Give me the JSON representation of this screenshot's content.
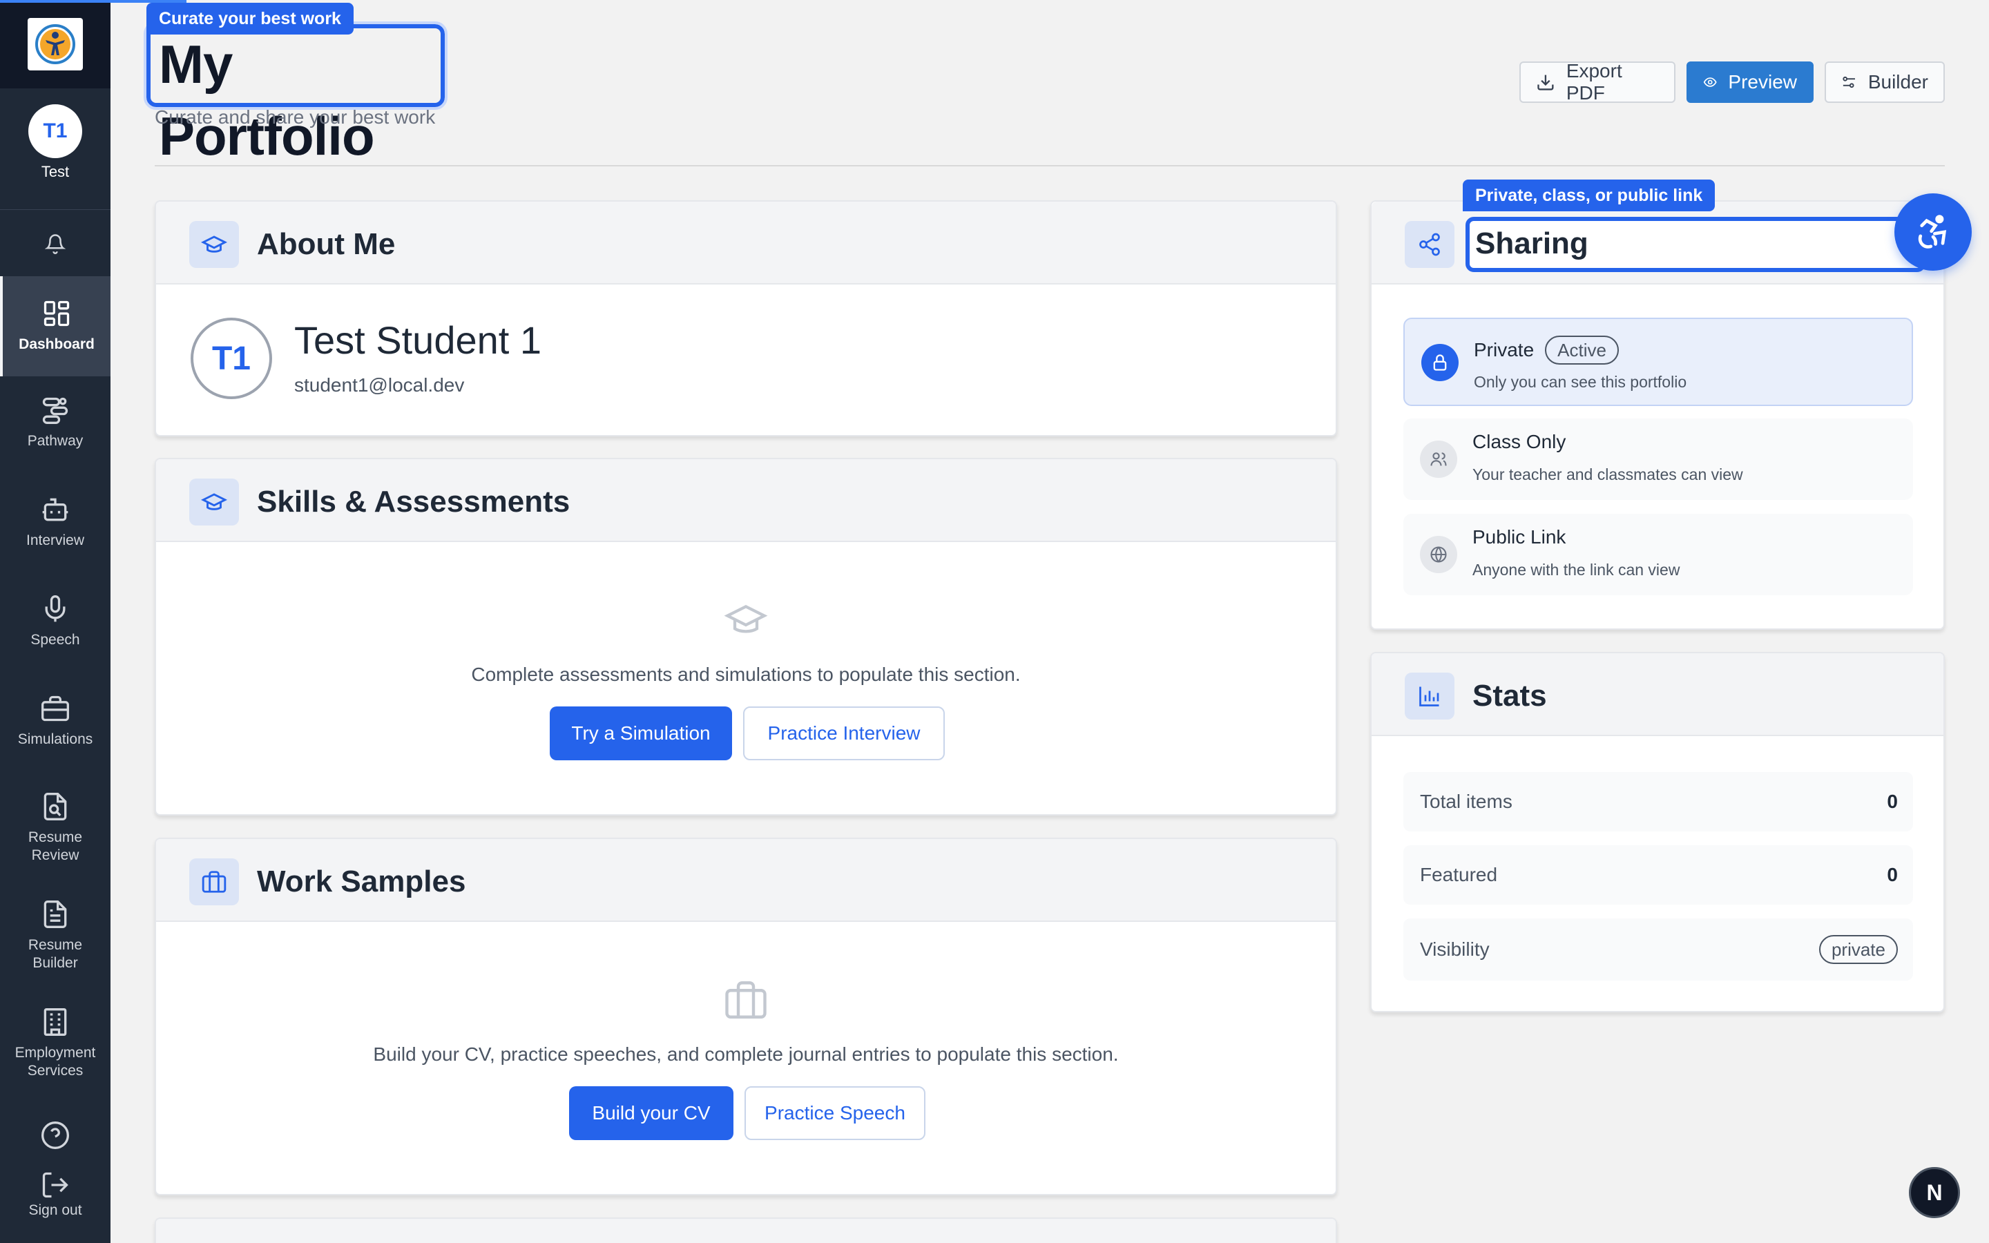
{
  "sidebar": {
    "profile": {
      "initials": "T1",
      "name": "Test"
    },
    "items": [
      {
        "label": "Dashboard",
        "icon": "dashboard-icon",
        "active": true
      },
      {
        "label": "Pathway",
        "icon": "pathway-icon"
      },
      {
        "label": "Interview",
        "icon": "robot-icon"
      },
      {
        "label": "Speech",
        "icon": "microphone-icon"
      },
      {
        "label": "Simulations",
        "icon": "briefcase-icon"
      },
      {
        "label": "Resume Review",
        "icon": "file-search-icon"
      },
      {
        "label": "Resume Builder",
        "icon": "file-text-icon"
      },
      {
        "label": "Employment Services",
        "icon": "building-icon"
      }
    ],
    "sign_out": "Sign out"
  },
  "header": {
    "tooltip": "Curate your best work",
    "title": "My Portfolio",
    "subtitle": "Curate and share your best work",
    "buttons": {
      "export": "Export PDF",
      "preview": "Preview",
      "builder": "Builder"
    }
  },
  "about": {
    "title": "About Me",
    "initials": "T1",
    "name": "Test Student 1",
    "email": "student1@local.dev"
  },
  "skills": {
    "title": "Skills & Assessments",
    "empty_text": "Complete assessments and simulations to populate this section.",
    "primary_button": "Try a Simulation",
    "secondary_button": "Practice Interview"
  },
  "work": {
    "title": "Work Samples",
    "empty_text": "Build your CV, practice speeches, and complete journal entries to populate this section.",
    "primary_button": "Build your CV",
    "secondary_button": "Practice Speech"
  },
  "sharing": {
    "tooltip": "Private, class, or public link",
    "title": "Sharing",
    "options": [
      {
        "title": "Private",
        "badge": "Active",
        "desc": "Only you can see this portfolio",
        "icon": "lock-icon"
      },
      {
        "title": "Class Only",
        "desc": "Your teacher and classmates can view",
        "icon": "users-icon"
      },
      {
        "title": "Public Link",
        "desc": "Anyone with the link can view",
        "icon": "globe-icon"
      }
    ]
  },
  "stats": {
    "title": "Stats",
    "rows": [
      {
        "label": "Total items",
        "value": "0"
      },
      {
        "label": "Featured",
        "value": "0"
      },
      {
        "label": "Visibility",
        "value": "private"
      }
    ]
  },
  "fab": {
    "dev_badge": "N"
  },
  "colors": {
    "accent": "#2563eb",
    "sidebar": "#1f2937",
    "preview_button": "#2b7bd0"
  }
}
